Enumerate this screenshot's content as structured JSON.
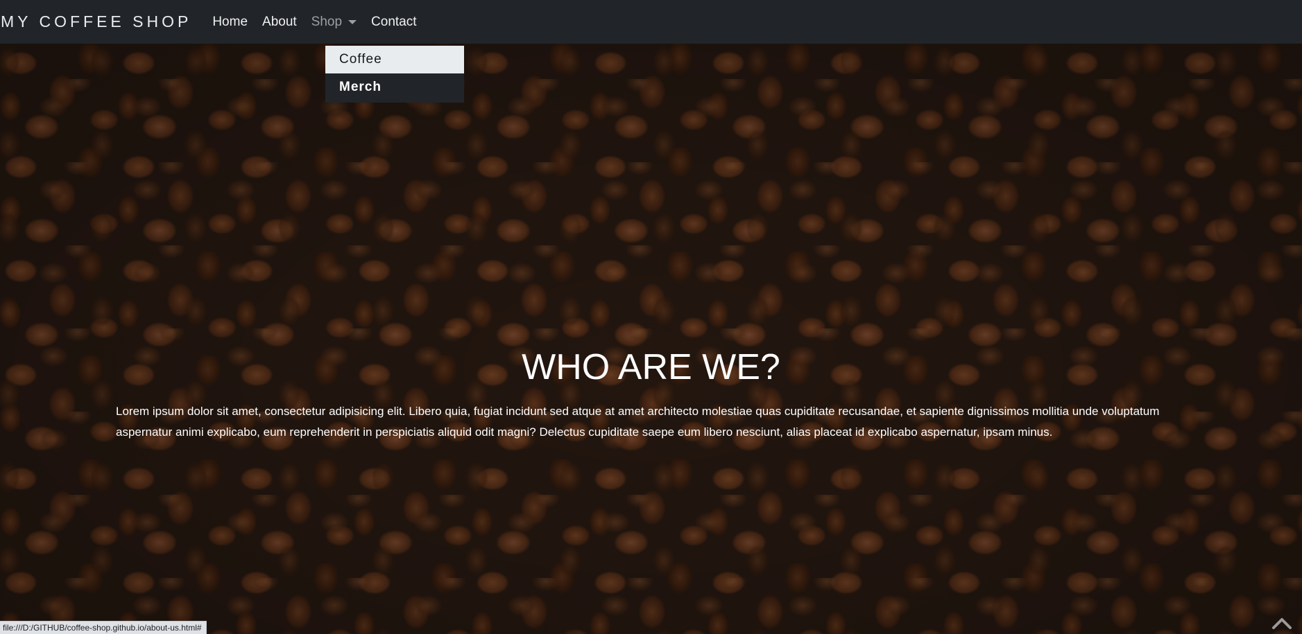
{
  "navbar": {
    "brand": "MY COFFEE SHOP",
    "links": {
      "home": "Home",
      "about": "About",
      "shop": "Shop",
      "contact": "Contact"
    }
  },
  "dropdown": {
    "items": [
      "Coffee",
      "Merch"
    ]
  },
  "hero": {
    "title": "WHO ARE WE?",
    "paragraph": "Lorem ipsum dolor sit amet, consectetur adipisicing elit. Libero quia, fugiat incidunt sed atque at amet architecto molestiae quas cupiditate recusandae, et sapiente dignissimos mollitia unde voluptatum aspernatur animi explicabo, eum reprehenderit in perspiciatis aliquid odit magni? Delectus cupiditate saepe eum libero nesciunt, alias placeat id explicabo aspernatur, ipsam minus."
  },
  "status_bar": {
    "text": "file:///D:/GITHUB/coffee-shop.github.io/about-us.html#"
  },
  "colors": {
    "navbar_bg": "#212529",
    "dropdown_hover_bg": "#e9ecef",
    "text_light": "#ffffff"
  },
  "icons": {
    "dropdown_caret": "caret-down-icon",
    "scroll_top": "chevron-up-icon"
  }
}
